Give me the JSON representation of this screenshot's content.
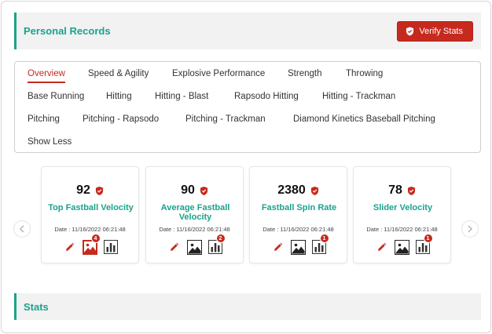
{
  "header": {
    "title": "Personal Records",
    "verify_label": "Verify Stats"
  },
  "tabs": [
    {
      "label": "Overview",
      "active": true
    },
    {
      "label": "Speed & Agility"
    },
    {
      "label": "Explosive Performance"
    },
    {
      "label": "Strength"
    },
    {
      "label": "Throwing"
    },
    {
      "label": "Base Running"
    },
    {
      "label": "Hitting"
    },
    {
      "label": "Hitting - Blast"
    },
    {
      "label": "Rapsodo Hitting"
    },
    {
      "label": "Hitting - Trackman"
    },
    {
      "label": "Pitching"
    },
    {
      "label": "Pitching - Rapsodo"
    },
    {
      "label": "Pitching - Trackman"
    },
    {
      "label": "Diamond Kinetics Baseball Pitching"
    },
    {
      "label": "Show Less"
    }
  ],
  "cards": [
    {
      "value": "92",
      "label": "Top Fastball Velocity",
      "date": "Date : 11/16/2022 06:21:48",
      "media_badge": "4",
      "chart_badge": "",
      "media_active": true
    },
    {
      "value": "90",
      "label": "Average Fastball Velocity",
      "date": "Date : 11/16/2022 06:21:48",
      "media_badge": "",
      "chart_badge": "2",
      "media_active": false
    },
    {
      "value": "2380",
      "label": "Fastball Spin Rate",
      "date": "Date : 11/16/2022 06:21:48",
      "media_badge": "",
      "chart_badge": "1",
      "media_active": false
    },
    {
      "value": "78",
      "label": "Slider Velocity",
      "date": "Date : 11/16/2022 06:21:48",
      "media_badge": "",
      "chart_badge": "1",
      "media_active": false
    }
  ],
  "carousel": {
    "prev_icon": "chevron-left-icon",
    "next_icon": "chevron-right-icon"
  },
  "stats": {
    "title": "Stats"
  },
  "colors": {
    "accent": "#1aa38a",
    "brand_red": "#c62a1e",
    "section_bg": "#f2f2f2"
  }
}
